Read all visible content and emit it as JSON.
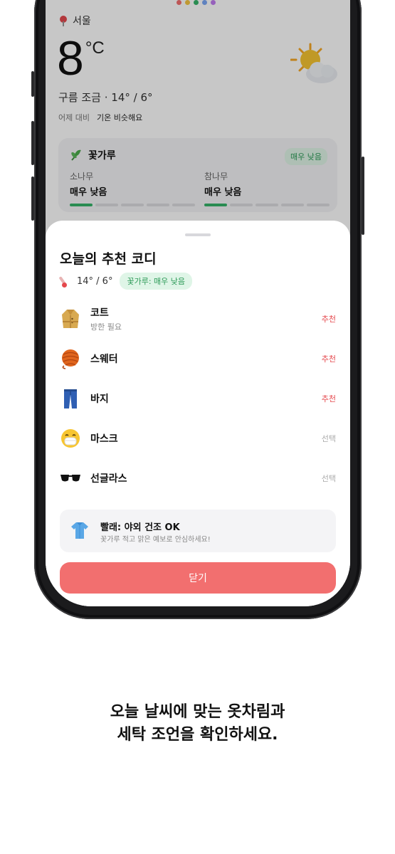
{
  "weather": {
    "dot_colors": [
      "#f26f6f",
      "#f5c542",
      "#35b46a",
      "#7aa7f5",
      "#c07cf0"
    ],
    "location": "서울",
    "temperature": "8",
    "unit": "°C",
    "condition": "구름 조금 · 14° / 6°",
    "comparison_label": "어제 대비",
    "comparison_value": "기온 비슷해요",
    "icon": "sun-behind-cloud-icon",
    "pollen": {
      "title": "꽃가루",
      "badge": "매우 낮음",
      "trees": [
        {
          "name": "소나무",
          "level": "매우 낮음",
          "filled": 1,
          "of": 5
        },
        {
          "name": "참나무",
          "level": "매우 낮음",
          "filled": 1,
          "of": 5
        }
      ]
    }
  },
  "sheet": {
    "title": "오늘의 추천 코디",
    "temp_summary": "14° / 6°",
    "pollen_pill": "꽃가루: 매우 낮음",
    "items": [
      {
        "icon": "coat-icon",
        "name": "코트",
        "note": "방한 필요",
        "tag": "추천",
        "tag_type": "recommended"
      },
      {
        "icon": "sweater-yarn-icon",
        "name": "스웨터",
        "note": "",
        "tag": "추천",
        "tag_type": "recommended"
      },
      {
        "icon": "jeans-icon",
        "name": "바지",
        "note": "",
        "tag": "추천",
        "tag_type": "recommended"
      },
      {
        "icon": "mask-face-icon",
        "name": "마스크",
        "note": "",
        "tag": "선택",
        "tag_type": "optional"
      },
      {
        "icon": "sunglasses-icon",
        "name": "선글라스",
        "note": "",
        "tag": "선택",
        "tag_type": "optional"
      }
    ],
    "laundry": {
      "icon": "shirt-icon",
      "title": "빨래: 야외 건조 OK",
      "subtitle": "꽃가루 적고 맑은 예보로 안심하세요!"
    },
    "close_label": "닫기"
  },
  "colors": {
    "accent": "#f26f6f",
    "recommended": "#e5484d",
    "pollen_green": "#35b46a"
  },
  "caption": {
    "line1": "오늘 날씨에 맞는 옷차림과",
    "line2": "세탁 조언을 확인하세요."
  }
}
